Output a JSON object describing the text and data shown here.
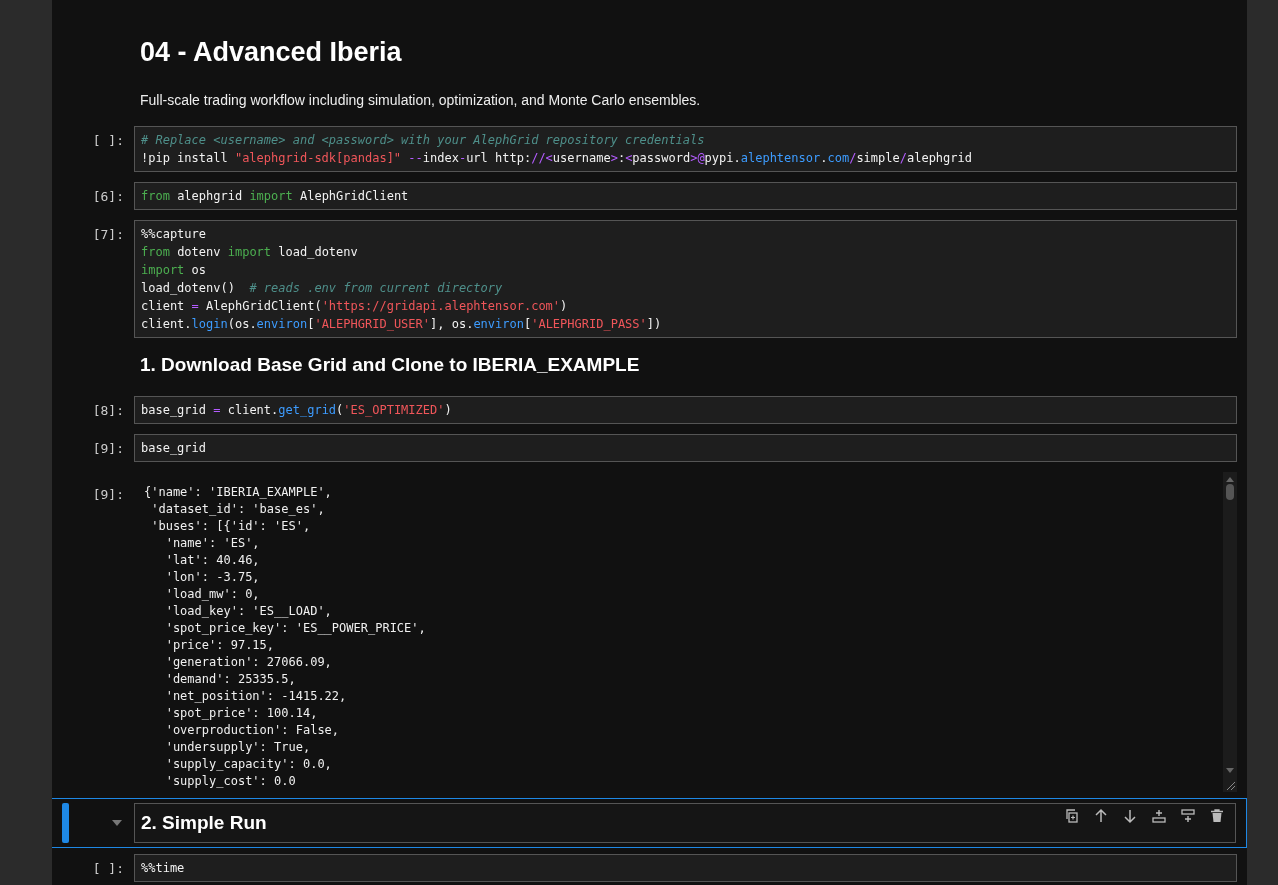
{
  "cells": [
    {
      "kind": "title",
      "text": "04 - Advanced Iberia"
    },
    {
      "kind": "text",
      "text": "Full-scale trading workflow including simulation, optimization, and Monte Carlo ensembles."
    },
    {
      "kind": "code",
      "prompt": "[ ]:",
      "lines": [
        [
          {
            "kind": "comment",
            "text": "# Replace <username> and <password> with your AlephGrid repository credentials"
          }
        ],
        [
          {
            "kind": "plain",
            "text": "!pip install "
          },
          {
            "kind": "string",
            "text": "\"alephgrid-sdk[pandas]\""
          },
          {
            "kind": "operator",
            "text": " --"
          },
          {
            "kind": "plain",
            "text": "index"
          },
          {
            "kind": "operator",
            "text": "-"
          },
          {
            "kind": "plain",
            "text": "url http:"
          },
          {
            "kind": "operator",
            "text": "//<"
          },
          {
            "kind": "plain",
            "text": "username"
          },
          {
            "kind": "operator",
            "text": ">"
          },
          {
            "kind": "plain",
            "text": ":"
          },
          {
            "kind": "operator",
            "text": "<"
          },
          {
            "kind": "plain",
            "text": "password"
          },
          {
            "kind": "operator",
            "text": ">@"
          },
          {
            "kind": "plain",
            "text": "pypi."
          },
          {
            "kind": "attribute",
            "text": "alephtensor"
          },
          {
            "kind": "plain",
            "text": "."
          },
          {
            "kind": "attribute",
            "text": "com"
          },
          {
            "kind": "operator",
            "text": "/"
          },
          {
            "kind": "plain",
            "text": "simple"
          },
          {
            "kind": "operator",
            "text": "/"
          },
          {
            "kind": "plain",
            "text": "alephgrid"
          }
        ]
      ]
    },
    {
      "kind": "code",
      "prompt": "[6]:",
      "lines": [
        [
          {
            "kind": "keyword",
            "text": "from"
          },
          {
            "kind": "plain",
            "text": " alephgrid "
          },
          {
            "kind": "keyword",
            "text": "import"
          },
          {
            "kind": "plain",
            "text": " AlephGridClient"
          }
        ]
      ]
    },
    {
      "kind": "code",
      "prompt": "[7]:",
      "lines": [
        [
          {
            "kind": "plain",
            "text": "%%capture"
          }
        ],
        [
          {
            "kind": "keyword",
            "text": "from"
          },
          {
            "kind": "plain",
            "text": " dotenv "
          },
          {
            "kind": "keyword",
            "text": "import"
          },
          {
            "kind": "plain",
            "text": " load_dotenv"
          }
        ],
        [
          {
            "kind": "keyword",
            "text": "import"
          },
          {
            "kind": "plain",
            "text": " os"
          }
        ],
        [
          {
            "kind": "plain",
            "text": "load_dotenv()  "
          },
          {
            "kind": "comment",
            "text": "# reads .env from current directory"
          }
        ],
        [
          {
            "kind": "plain",
            "text": "client "
          },
          {
            "kind": "operator",
            "text": "="
          },
          {
            "kind": "plain",
            "text": " AlephGridClient("
          },
          {
            "kind": "string",
            "text": "'https://gridapi.alephtensor.com'"
          },
          {
            "kind": "plain",
            "text": ")"
          }
        ],
        [
          {
            "kind": "plain",
            "text": "client."
          },
          {
            "kind": "attribute",
            "text": "login"
          },
          {
            "kind": "plain",
            "text": "(os."
          },
          {
            "kind": "attribute",
            "text": "environ"
          },
          {
            "kind": "plain",
            "text": "["
          },
          {
            "kind": "string",
            "text": "'ALEPHGRID_USER'"
          },
          {
            "kind": "plain",
            "text": "], os."
          },
          {
            "kind": "attribute",
            "text": "environ"
          },
          {
            "kind": "plain",
            "text": "["
          },
          {
            "kind": "string",
            "text": "'ALEPHGRID_PASS'"
          },
          {
            "kind": "plain",
            "text": "])"
          }
        ]
      ]
    },
    {
      "kind": "heading",
      "text": "1. Download Base Grid and Clone to IBERIA_EXAMPLE"
    },
    {
      "kind": "code",
      "prompt": "[8]:",
      "lines": [
        [
          {
            "kind": "plain",
            "text": "base_grid "
          },
          {
            "kind": "operator",
            "text": "="
          },
          {
            "kind": "plain",
            "text": " client."
          },
          {
            "kind": "attribute",
            "text": "get_grid"
          },
          {
            "kind": "plain",
            "text": "("
          },
          {
            "kind": "string",
            "text": "'ES_OPTIMIZED'"
          },
          {
            "kind": "plain",
            "text": ")"
          }
        ]
      ]
    },
    {
      "kind": "code",
      "prompt": "[9]:",
      "lines": [
        [
          {
            "kind": "plain",
            "text": "base_grid"
          }
        ]
      ]
    },
    {
      "kind": "output",
      "prompt": "[9]:",
      "lines": [
        "{'name': 'IBERIA_EXAMPLE',",
        " 'dataset_id': 'base_es',",
        " 'buses': [{'id': 'ES',",
        "   'name': 'ES',",
        "   'lat': 40.46,",
        "   'lon': -3.75,",
        "   'load_mw': 0,",
        "   'load_key': 'ES__LOAD',",
        "   'spot_price_key': 'ES__POWER_PRICE',",
        "   'price': 97.15,",
        "   'generation': 27066.09,",
        "   'demand': 25335.5,",
        "   'net_position': -1415.22,",
        "   'spot_price': 100.14,",
        "   'overproduction': False,",
        "   'undersupply': True,",
        "   'supply_capacity': 0.0,",
        "   'supply_cost': 0.0"
      ]
    },
    {
      "kind": "heading",
      "text": "2. Simple Run",
      "selected": true
    },
    {
      "kind": "code",
      "prompt": "[ ]:",
      "lines": [
        [
          {
            "kind": "plain",
            "text": "%%time"
          }
        ]
      ]
    }
  ]
}
